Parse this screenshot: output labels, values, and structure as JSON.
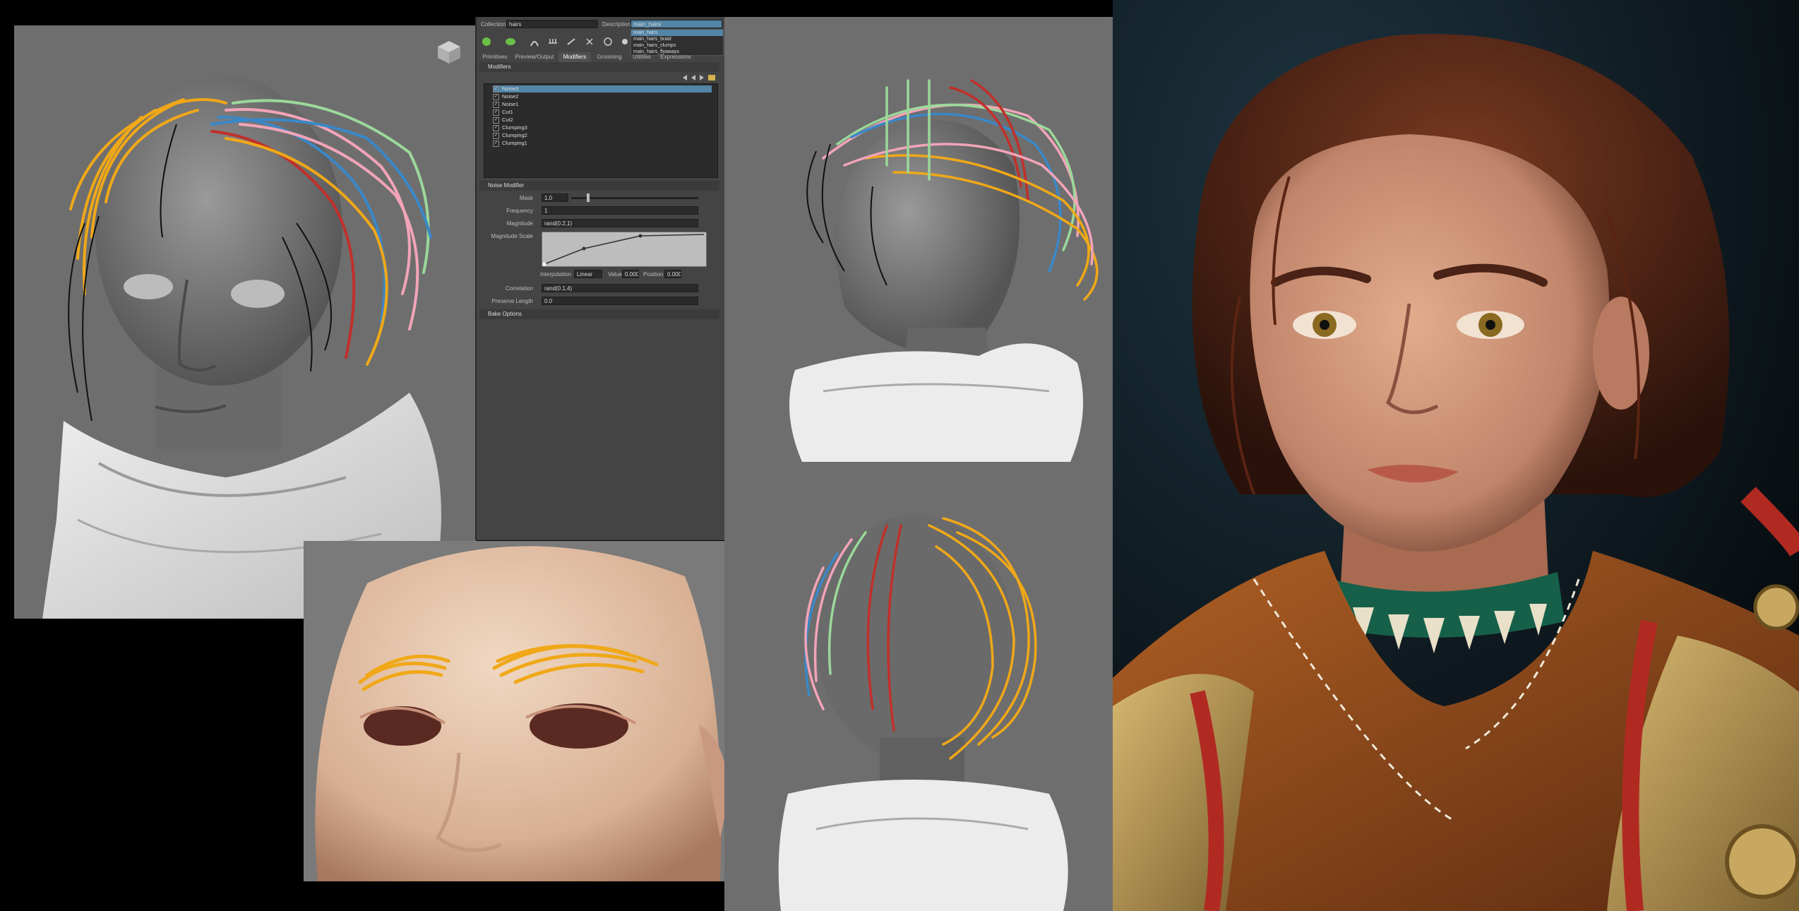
{
  "xgen": {
    "collection_label": "Collection:",
    "collection_value": "hairs",
    "description_label": "Description:",
    "description_value": "main_hairs",
    "description_options": [
      "main_hairs",
      "main_hairs_braid",
      "main_hairs_clumps",
      "main_hairs_flyaways"
    ],
    "tabs": [
      "Primitives",
      "Preview/Output",
      "Modifiers",
      "Grooming",
      "Utilities",
      "Expressions"
    ],
    "active_tab": "Modifiers",
    "modifiers_header": "Modifiers",
    "modifier_list": [
      "Noise3",
      "Noise2",
      "Noise1",
      "Cut1",
      "Cut2",
      "Clumping3",
      "Clumping2",
      "Clumping1"
    ],
    "noise_header": "Noise Modifier",
    "fields": {
      "mask_label": "Mask",
      "mask_value": "1.0",
      "frequency_label": "Frequency",
      "frequency_value": "1",
      "magnitude_label": "Magnitude",
      "magnitude_value": "rand(0.2,1)",
      "magnitude_scale_label": "Magnitude Scale",
      "interpolation_label": "Interpolation",
      "interpolation_value": "Linear",
      "value_label": "Value",
      "value_value": "0.000",
      "position_label": "Position",
      "position_value": "0.000",
      "correlation_label": "Correlation",
      "correlation_value": "rand(0.1,4)",
      "preserve_length_label": "Preserve Length",
      "preserve_length_value": "0.0"
    },
    "bake_header": "Bake Options"
  },
  "colors": {
    "viewport_bg": "#6e6e6e",
    "panel_bg": "#444444",
    "highlight": "#5285a6",
    "hair_orange": "#f0a818",
    "hair_pink": "#f2a4b8",
    "hair_blue": "#3a88c8",
    "hair_green": "#9bd89a",
    "hair_red": "#c0302a",
    "render_bg": "#0c1a22"
  },
  "icons": [
    "view-cube-icon",
    "checkbox-icon",
    "gear-icon",
    "arrow-icon"
  ]
}
